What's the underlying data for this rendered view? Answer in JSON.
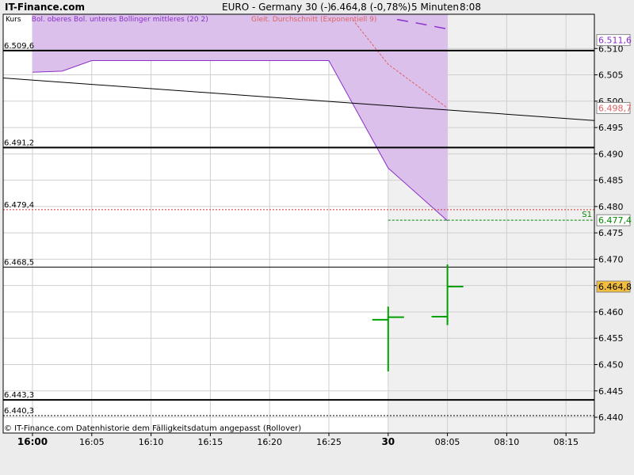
{
  "header": {
    "site": "IT-Finance.com",
    "instrument": "EURO - Germany 30 (-)",
    "quote": "6.464,8 (-0,78%)",
    "interval": "5 Minuten",
    "time": "8:08"
  },
  "footer_note": "© IT-Finance.com  Datenhistorie dem Fälligkeitsdatum angepasst (Rollover)",
  "colors": {
    "bollinger_fill": "#dcc0ec",
    "bollinger_line": "#8a2fc8",
    "ema": "#e06060",
    "price": "#00a000",
    "level_line": "#000000",
    "resistance": "#cc3333",
    "support": "#008800",
    "current_badge": "#f2bd3c",
    "session_shade": "#f0f0f0"
  },
  "chart_data": {
    "type": "candlestick",
    "title": "EURO - Germany 30 (-)",
    "ylim": [
      6.437,
      6.5165
    ],
    "x_tick_labels": [
      "16:00",
      "16:05",
      "16:10",
      "16:15",
      "16:20",
      "16:25",
      "30",
      "08:05",
      "08:10",
      "08:15"
    ],
    "y_tick_labels": [
      "6.510",
      "6.505",
      "6.500",
      "6.495",
      "6.490",
      "6.485",
      "6.480",
      "6.475",
      "6.470",
      "6.465",
      "6.460",
      "6.455",
      "6.450",
      "6.445",
      "6.440"
    ],
    "y_ticks": [
      6.51,
      6.505,
      6.5,
      6.495,
      6.49,
      6.485,
      6.48,
      6.475,
      6.47,
      6.465,
      6.46,
      6.455,
      6.45,
      6.445,
      6.44
    ],
    "legend": [
      {
        "label": "Kurs",
        "color": "#000000"
      },
      {
        "label": "Bol. oberes Bol. unteres Bollinger mittleres (20 2)",
        "color": "#8a2fc8"
      },
      {
        "label": "Gleit. Durchschnitt (Exponentiell 9)",
        "color": "#e06060"
      }
    ],
    "levels": [
      {
        "label": "6.509,6",
        "value": 6.5096,
        "style": "solid-thick"
      },
      {
        "label": "6.491,2",
        "value": 6.4912,
        "style": "solid-thick"
      },
      {
        "label": "6.479,4",
        "value": 6.4794,
        "style": "dotted-red"
      },
      {
        "label": "6.468,5",
        "value": 6.4685,
        "style": "solid"
      },
      {
        "label": "6.443,3",
        "value": 6.4433,
        "style": "solid-thick"
      },
      {
        "label": "6.440,3",
        "value": 6.4403,
        "style": "dotted"
      }
    ],
    "support": {
      "label": "S1",
      "value": 6.4774,
      "value_label": "6.477,4"
    },
    "trend_line": {
      "from": [
        0,
        6.504
      ],
      "to": [
        10,
        6.4959
      ]
    },
    "bollinger_lower": [
      [
        0,
        6.5055
      ],
      [
        0.5,
        6.5057
      ],
      [
        1,
        6.5077
      ],
      [
        5,
        6.5077
      ],
      [
        6,
        6.4873
      ],
      [
        7,
        6.4773
      ]
    ],
    "bollinger_upper_segment": [
      [
        6.15,
        6.5155
      ],
      [
        6.5,
        6.5148
      ],
      [
        7,
        6.5137
      ]
    ],
    "ema": [
      [
        5.4,
        6.5155
      ],
      [
        6,
        6.507
      ],
      [
        7,
        6.4987
      ]
    ],
    "candles": [
      {
        "x": 6,
        "open": 6.4585,
        "high": 6.461,
        "low": 6.4487,
        "close": 6.459
      },
      {
        "x": 7,
        "open": 6.4591,
        "high": 6.469,
        "low": 6.4575,
        "close": 6.4648
      }
    ],
    "right_badges": [
      {
        "label": "6.511,6",
        "value": 6.5116,
        "bg": "#ffffff",
        "fg": "#8a2fc8"
      },
      {
        "label": "6.498,7",
        "value": 6.4987,
        "bg": "#ffffff",
        "fg": "#e06060"
      },
      {
        "label": "6.477,4",
        "value": 6.4774,
        "bg": "#ffffff",
        "fg": "#008800"
      },
      {
        "label": "6.464,8",
        "value": 6.4648,
        "bg": "#f2bd3c",
        "fg": "#000000"
      }
    ]
  }
}
